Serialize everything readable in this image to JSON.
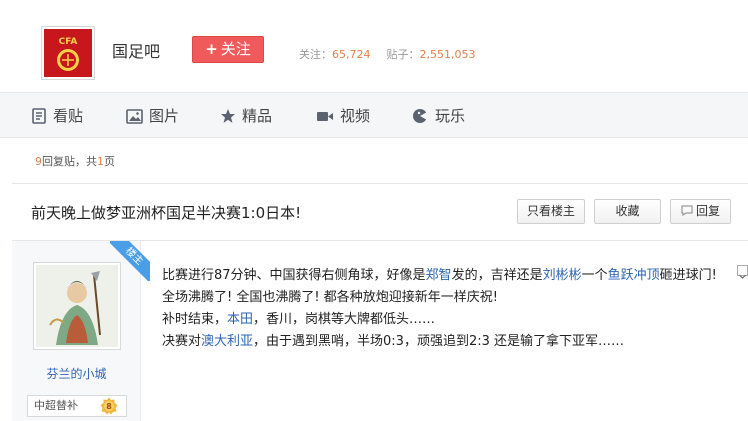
{
  "header": {
    "forum_name": "国足吧",
    "follow_label": "关注",
    "follow_plus": "+",
    "stats": {
      "follow_label": "关注：",
      "follow_count": "65,724",
      "post_label": "贴子：",
      "post_count": "2,551,053"
    },
    "logo_text": "CFA"
  },
  "nav": {
    "items": [
      {
        "label": "看贴",
        "icon": "document-icon"
      },
      {
        "label": "图片",
        "icon": "image-icon"
      },
      {
        "label": "精品",
        "icon": "star-icon"
      },
      {
        "label": "视频",
        "icon": "video-camera-icon"
      },
      {
        "label": "玩乐",
        "icon": "game-icon"
      }
    ]
  },
  "reply_info": {
    "count": "9",
    "reply_label": "回复贴，共",
    "pages": "1",
    "page_label": "页"
  },
  "thread": {
    "title": "前天晚上做梦亚洲杯国足半决赛1:0日本!",
    "only_op_label": "只看楼主",
    "favorite_label": "收藏",
    "reply_label": "回复"
  },
  "post": {
    "op_badge": "楼主",
    "author": "芬兰的小城",
    "level_name": "中超替补",
    "level_num": "8",
    "lines": {
      "l1_a": "比赛进行87分钟、中国获得右侧角球，好像是",
      "l1_link1": "郑智",
      "l1_b": "发的，吉祥还是",
      "l1_link2": "刘彬彬",
      "l1_c": "一个",
      "l1_link3": "鱼跃冲顶",
      "l1_d": "砸进球门!",
      "l2": "全场沸腾了!  全国也沸腾了!  都各种放炮迎接新年一样庆祝!",
      "l3_a": "补时结束，",
      "l3_link": "本田",
      "l3_b": "，香川，岗棋等大牌都低头……",
      "l4_a": "决赛对",
      "l4_link": "澳大利亚",
      "l4_b": "，由于遇到黑哨，半场0:3，顽强追到2:3 还是输了拿下亚军……"
    }
  },
  "colors": {
    "accent_red": "#f15a5a",
    "link_blue": "#2d64b3",
    "number_orange": "#e0804a",
    "op_badge_blue": "#4a9ee8"
  }
}
